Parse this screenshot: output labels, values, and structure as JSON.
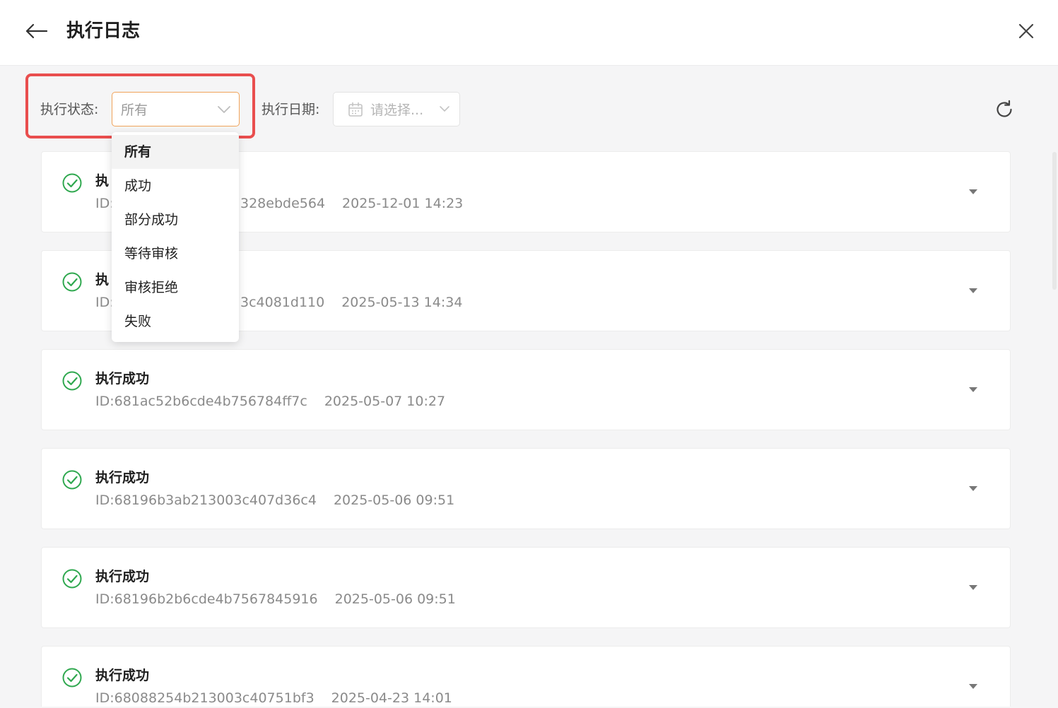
{
  "header": {
    "title": "执行日志"
  },
  "filters": {
    "status_label": "执行状态:",
    "status_value": "所有",
    "date_label": "执行日期:",
    "date_placeholder": "请选择..."
  },
  "dropdown": {
    "options": [
      "所有",
      "成功",
      "部分成功",
      "等待审核",
      "审核拒绝",
      "失败"
    ],
    "selected": "所有"
  },
  "logs": [
    {
      "title": "执",
      "id": "ID:",
      "id_tail": "328ebde564",
      "time": "2025-12-01 14:23"
    },
    {
      "title": "执",
      "id": "ID:",
      "id_tail": "3c4081d110",
      "time": "2025-05-13 14:34"
    },
    {
      "title": "执行成功",
      "id": "ID:681ac52b6cde4b756784ff7c",
      "time": "2025-05-07 10:27"
    },
    {
      "title": "执行成功",
      "id": "ID:68196b3ab213003c407d36c4",
      "time": "2025-05-06 09:51"
    },
    {
      "title": "执行成功",
      "id": "ID:68196b2b6cde4b7567845916",
      "time": "2025-05-06 09:51"
    },
    {
      "title": "执行成功",
      "id": "ID:68088254b213003c40751bf3",
      "time": "2025-04-23 14:01"
    }
  ],
  "colors": {
    "success": "#2fa84f",
    "highlight": "#e94e4e",
    "focus_border": "#f0a35a"
  }
}
